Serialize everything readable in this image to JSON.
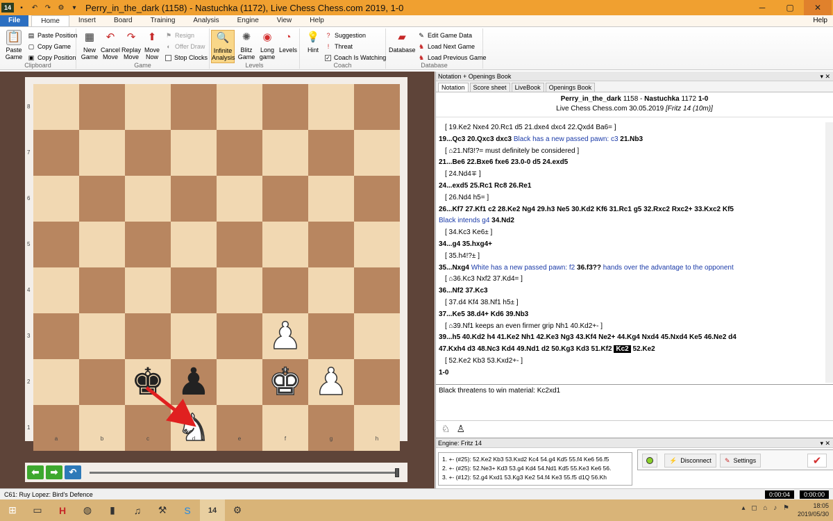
{
  "window": {
    "title": "Perry_in_the_dark (1158) - Nastuchka (1172), Live Chess Chess.com 2019, 1-0",
    "app_badge": "14"
  },
  "tabs": [
    "File",
    "Home",
    "Insert",
    "Board",
    "Training",
    "Analysis",
    "Engine",
    "View",
    "Help"
  ],
  "help_label": "Help",
  "ribbon": {
    "clipboard": {
      "label": "Clipboard",
      "paste_game": "Paste Game",
      "paste_position": "Paste Position",
      "copy_game": "Copy Game",
      "copy_position": "Copy Position"
    },
    "game": {
      "label": "Game",
      "new_game": "New Game",
      "cancel_move": "Cancel Move",
      "replay_move": "Replay Move",
      "move_now": "Move Now",
      "resign": "Resign",
      "offer_draw": "Offer Draw",
      "stop_clocks": "Stop Clocks"
    },
    "levels": {
      "label": "Levels",
      "infinite_analysis": "Infinite Analysis",
      "blitz_game": "Blitz Game",
      "long_game": "Long game",
      "levels": "Levels"
    },
    "coach": {
      "label": "Coach",
      "hint": "Hint",
      "suggestion": "Suggestion",
      "threat": "Threat",
      "coach_watching": "Coach Is Watching"
    },
    "database": {
      "label": "Database",
      "database": "Database",
      "edit_game_data": "Edit Game Data",
      "load_next_game": "Load Next Game",
      "load_previous_game": "Load Previous Game"
    }
  },
  "board": {
    "files": [
      "a",
      "b",
      "c",
      "d",
      "e",
      "f",
      "g",
      "h"
    ],
    "ranks": [
      "8",
      "7",
      "6",
      "5",
      "4",
      "3",
      "2",
      "1"
    ],
    "pieces": [
      {
        "square": "f3",
        "piece": "white-pawn",
        "glyph": "♟"
      },
      {
        "square": "c2",
        "piece": "black-king",
        "glyph": "♚"
      },
      {
        "square": "d2",
        "piece": "black-pawn",
        "glyph": "♟"
      },
      {
        "square": "f2",
        "piece": "white-king",
        "glyph": "♚"
      },
      {
        "square": "g2",
        "piece": "white-pawn",
        "glyph": "♟"
      },
      {
        "square": "d1",
        "piece": "white-knight",
        "glyph": "♞"
      }
    ],
    "arrow": {
      "from": "c2",
      "to": "d1",
      "color": "#e02020"
    }
  },
  "status": {
    "opening": "C61: Ruy Lopez: Bird's Defence",
    "clock_white": "0:00:04",
    "clock_black": "0:00:00"
  },
  "notation": {
    "pane_title": "Notation + Openings Book",
    "tabs": [
      "Notation",
      "Score sheet",
      "LiveBook",
      "Openings Book"
    ],
    "white_player": "Perry_in_the_dark",
    "white_elo": "1158",
    "black_player": "Nastuchka",
    "black_elo": "1172",
    "result": "1-0",
    "event_line": "Live Chess Chess.com 30.05.2019",
    "event_note": "[Fritz 14 (10m)]",
    "lines": [
      {
        "type": "var",
        "text": "[ 19.Ke2  Nxe4  20.Rc1  d5  21.dxe4  dxc4  22.Qxd4  Ba6= ]"
      },
      {
        "type": "main",
        "text": "19...Qc3  20.Qxc3  dxc3",
        "comment": " Black has a new passed pawn: c3 ",
        "after": "21.Nb3"
      },
      {
        "type": "var",
        "text": "[ ⌂21.Nf3!?= must definitely be considered ]"
      },
      {
        "type": "main",
        "text": "21...Be6  22.Bxe6  fxe6  23.0-0  d5  24.exd5"
      },
      {
        "type": "var",
        "text": "[ 24.Nd4∓ ]"
      },
      {
        "type": "main",
        "text": "24...exd5  25.Rc1  Rc8  26.Re1"
      },
      {
        "type": "var",
        "text": "[ 26.Nd4  h5= ]"
      },
      {
        "type": "main",
        "text": "26...Kf7  27.Kf1  c2  28.Ke2  Ng4  29.h3  Ne5  30.Kd2  Kf6  31.Rc1  g5  32.Rxc2  Rxc2+  33.Kxc2  Kf5"
      },
      {
        "type": "comment",
        "text": "Black intends g4 ",
        "after": "34.Nd2"
      },
      {
        "type": "var",
        "text": "[ 34.Kc3  Ke6± ]"
      },
      {
        "type": "main",
        "text": "34...g4  35.hxg4+"
      },
      {
        "type": "var",
        "text": "[ 35.h4!?± ]"
      },
      {
        "type": "main",
        "text": "35...Nxg4",
        "comment": " White has a new passed pawn: f2 ",
        "after": "36.f3??",
        "comment2": " hands over the advantage to the opponent"
      },
      {
        "type": "var",
        "text": "[ ⌂36.Kc3  Nxf2  37.Kd4= ]"
      },
      {
        "type": "main",
        "text": "36...Nf2  37.Kc3"
      },
      {
        "type": "var",
        "text": "[ 37.d4  Kf4  38.Nf1  h5± ]"
      },
      {
        "type": "main",
        "text": "37...Ke5  38.d4+  Kd6  39.Nb3"
      },
      {
        "type": "var",
        "text": "[ ⌂39.Nf1 keeps an even firmer grip  Nh1  40.Kd2+- ]"
      },
      {
        "type": "main",
        "text": "39...h5  40.Kd2  h4  41.Ke2  Nh1  42.Ke3  Ng3  43.Kf4  Ne2+  44.Kg4  Nxd4  45.Nxd4  Ke5  46.Ne2  d4"
      },
      {
        "type": "main",
        "text": "47.Kxh4  d3  48.Nc3  Kd4  49.Nd1  d2  50.Kg3  Kd3  51.Kf2",
        "highlight": "Kc2",
        "after": "52.Ke2"
      },
      {
        "type": "var",
        "text": "[ 52.Ke2  Kb3  53.Kxd2+- ]"
      },
      {
        "type": "main",
        "text": "1-0"
      }
    ]
  },
  "threat_text": "Black threatens to win material: Kc2xd1",
  "engine": {
    "title": "Engine: Fritz 14",
    "lines": [
      "1. +- (#25): 52.Ke2 Kb3 53.Kxd2 Kc4 54.g4 Kd5 55.f4 Ke6 56.f5",
      "2. +- (#25): 52.Ne3+ Kd3 53.g4 Kd4 54.Nd1 Kd5 55.Ke3 Ke6 56.",
      "3. +- (#12): 52.g4 Kxd1 53.Kg3 Ke2 54.f4 Ke3 55.f5 d1Q 56.Kh"
    ],
    "disconnect": "Disconnect",
    "settings": "Settings"
  },
  "taskbar": {
    "time": "18:05",
    "date": "2019/05/30"
  }
}
